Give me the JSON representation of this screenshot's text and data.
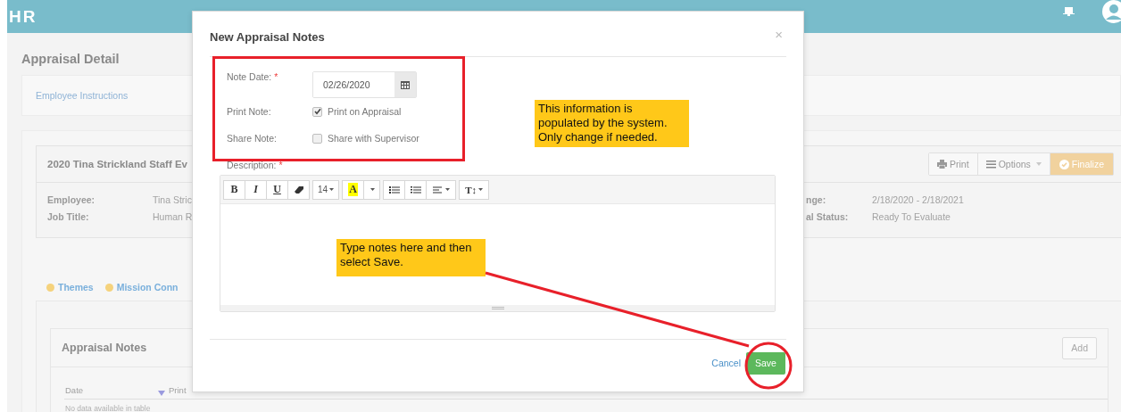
{
  "header": {
    "logo": "HR"
  },
  "page": {
    "title": "Appraisal Detail",
    "instructions_link": "Employee Instructions",
    "appraisal": {
      "title": "2020 Tina Strickland Staff Ev",
      "buttons": [
        {
          "label": "Print",
          "kind": "print"
        },
        {
          "label": "Options",
          "kind": "dropdown"
        },
        {
          "label": "Finalize",
          "kind": "finalize"
        }
      ],
      "fields": [
        {
          "label": "Employee:",
          "value": "Tina Stric"
        },
        {
          "label": "Job Title:",
          "value": "Human R"
        }
      ],
      "fields_right": [
        {
          "label": "nge:",
          "value": "2/18/2020 - 2/18/2021"
        },
        {
          "label": "al Status:",
          "value": "Ready To Evaluate"
        }
      ]
    },
    "tabs": [
      {
        "label": "Themes"
      },
      {
        "label": "Mission Conn"
      }
    ],
    "notes_panel": {
      "title": "Appraisal Notes",
      "add_button": "Add",
      "columns": [
        "Date",
        "Print"
      ],
      "empty_text": "No data available in table"
    }
  },
  "modal": {
    "title": "New Appraisal Notes",
    "close": "×",
    "note_date": {
      "label": "Note Date:",
      "required_mark": "*",
      "value": "02/26/2020"
    },
    "print_note": {
      "label": "Print Note:",
      "option": "Print on Appraisal",
      "checked": true
    },
    "share_note": {
      "label": "Share Note:",
      "option": "Share with Supervisor",
      "checked": false
    },
    "description": {
      "label": "Description:",
      "required_mark": "*"
    },
    "toolbar": [
      [
        {
          "kind": "bold",
          "text": "B"
        },
        {
          "kind": "italic",
          "text": "I"
        },
        {
          "kind": "underline",
          "text": "U"
        },
        {
          "kind": "eraser"
        }
      ],
      [
        {
          "kind": "size",
          "text": "14"
        }
      ],
      [
        {
          "kind": "color",
          "text": "A"
        },
        {
          "kind": "caret"
        }
      ],
      [
        {
          "kind": "ul"
        },
        {
          "kind": "ol"
        },
        {
          "kind": "align"
        }
      ],
      [
        {
          "kind": "height",
          "text": "T↕"
        }
      ]
    ],
    "cancel": "Cancel",
    "save": "Save"
  },
  "callouts": [
    {
      "text": "This information is populated by the system. Only change if needed."
    },
    {
      "text": "Type notes here and then select Save."
    }
  ]
}
